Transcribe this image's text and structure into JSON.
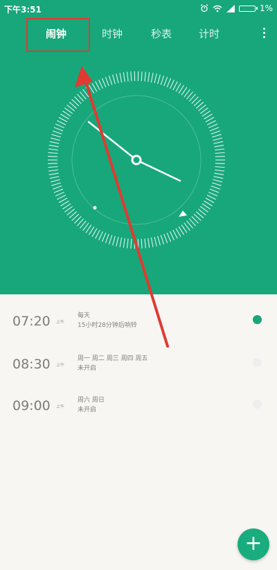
{
  "status_bar": {
    "time": "下午3:51",
    "battery": "1%"
  },
  "tabs": [
    {
      "label": "闹钟",
      "active": true
    },
    {
      "label": "时钟",
      "active": false
    },
    {
      "label": "秒表",
      "active": false
    },
    {
      "label": "计时",
      "active": false
    }
  ],
  "icons": {
    "menu": "more-vert-icon",
    "alarm_status": "alarm-clock-icon",
    "wifi": "wifi-icon",
    "signal": "signal-icon",
    "battery": "battery-icon",
    "add": "plus-icon"
  },
  "alarms": [
    {
      "time": "07:20",
      "ampm": "上午",
      "days": "每天",
      "status": "15小时28分钟后响铃",
      "enabled": true
    },
    {
      "time": "08:30",
      "ampm": "上午",
      "days": "周一 周二 周三 周四 周五",
      "status": "未开启",
      "enabled": false
    },
    {
      "time": "09:00",
      "ampm": "上午",
      "days": "周六 周日",
      "status": "未开启",
      "enabled": false
    }
  ],
  "fab": {
    "label": "+"
  },
  "colors": {
    "accent": "#17a77a",
    "annotation": "#e13a32"
  }
}
